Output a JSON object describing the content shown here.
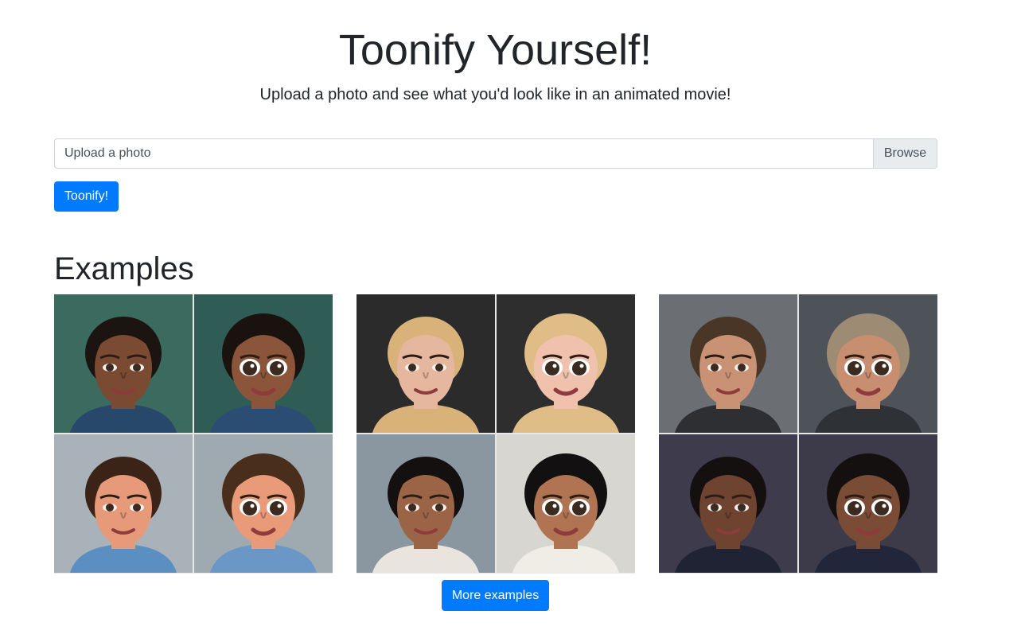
{
  "header": {
    "title": "Toonify Yourself!",
    "subtitle": "Upload a photo and see what you'd look like in an animated movie!"
  },
  "upload": {
    "label": "Upload a photo",
    "browse_label": "Browse",
    "submit_label": "Toonify!"
  },
  "examples": {
    "heading": "Examples",
    "more_label": "More examples",
    "groups": [
      {
        "pairs": [
          {
            "photo": {
              "bg": "#3a6b5e",
              "skin": "#7a4a33",
              "hair": "#1c1410",
              "shirt": "#27476b"
            },
            "toon": {
              "bg": "#2f5d56",
              "skin": "#8a553a",
              "hair": "#1a120e",
              "shirt": "#2b4d74"
            }
          },
          {
            "photo": {
              "bg": "#a9b2b8",
              "skin": "#e79a7a",
              "hair": "#3b2417",
              "shirt": "#5b8fc1"
            },
            "toon": {
              "bg": "#9fa9b0",
              "skin": "#e99a78",
              "hair": "#4a2e1c",
              "shirt": "#6a97c6"
            }
          }
        ]
      },
      {
        "pairs": [
          {
            "photo": {
              "bg": "#2b2b2b",
              "skin": "#e5b79f",
              "hair": "#d9b27a",
              "shirt": "#d9b27a"
            },
            "toon": {
              "bg": "#2e2e2e",
              "skin": "#f0c2ad",
              "hair": "#e0bd86",
              "shirt": "#e0bd86"
            }
          },
          {
            "photo": {
              "bg": "#8a97a0",
              "skin": "#9c6447",
              "hair": "#141010",
              "shirt": "#e9e4de"
            },
            "toon": {
              "bg": "#d8d6d0",
              "skin": "#b07452",
              "hair": "#121010",
              "shirt": "#f0ece6"
            }
          }
        ]
      },
      {
        "pairs": [
          {
            "photo": {
              "bg": "#6b6e72",
              "skin": "#c99275",
              "hair": "#4a3627",
              "shirt": "#2d2f33"
            },
            "toon": {
              "bg": "#4e535a",
              "skin": "#c78e70",
              "hair": "#9e8b74",
              "shirt": "#2e3136"
            }
          },
          {
            "photo": {
              "bg": "#3e3b4c",
              "skin": "#6e4330",
              "hair": "#151010",
              "shirt": "#1f2333"
            },
            "toon": {
              "bg": "#3d3a4a",
              "skin": "#7a4b35",
              "hair": "#151010",
              "shirt": "#22263a"
            }
          }
        ]
      }
    ]
  }
}
